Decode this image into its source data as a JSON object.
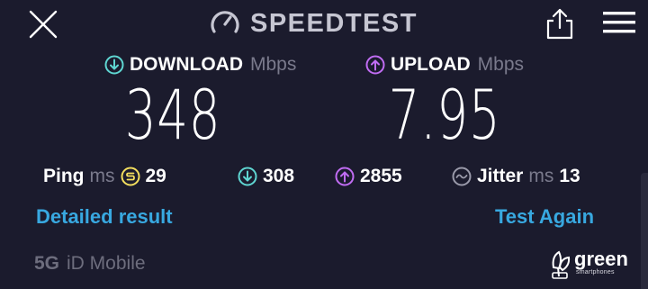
{
  "header": {
    "brand": "SPEEDTEST",
    "close_icon": "close-icon",
    "share_icon": "share-icon",
    "menu_icon": "hamburger-menu-icon"
  },
  "download": {
    "label": "DOWNLOAD",
    "unit": "Mbps",
    "value": "348",
    "icon": "download-arrow-icon"
  },
  "upload": {
    "label": "UPLOAD",
    "unit": "Mbps",
    "value": "7.95",
    "icon": "upload-arrow-icon"
  },
  "stats": {
    "ping": {
      "label": "Ping",
      "unit": "ms",
      "value": "29"
    },
    "download_latency": {
      "value": "308"
    },
    "upload_latency": {
      "value": "2855"
    },
    "jitter": {
      "label": "Jitter",
      "unit": "ms",
      "value": "13"
    }
  },
  "links": {
    "detailed": "Detailed result",
    "again": "Test Again"
  },
  "footer": {
    "provider_tech": "5G",
    "provider_name": "iD Mobile",
    "logo_word": "green",
    "logo_sub": "smartphones"
  },
  "colors": {
    "background": "#1b1b2d",
    "download_accent": "#5fd6d2",
    "upload_accent": "#c06cf2",
    "ping_accent": "#f4df5e",
    "link": "#38a8e0",
    "muted": "#7a7a8c"
  }
}
